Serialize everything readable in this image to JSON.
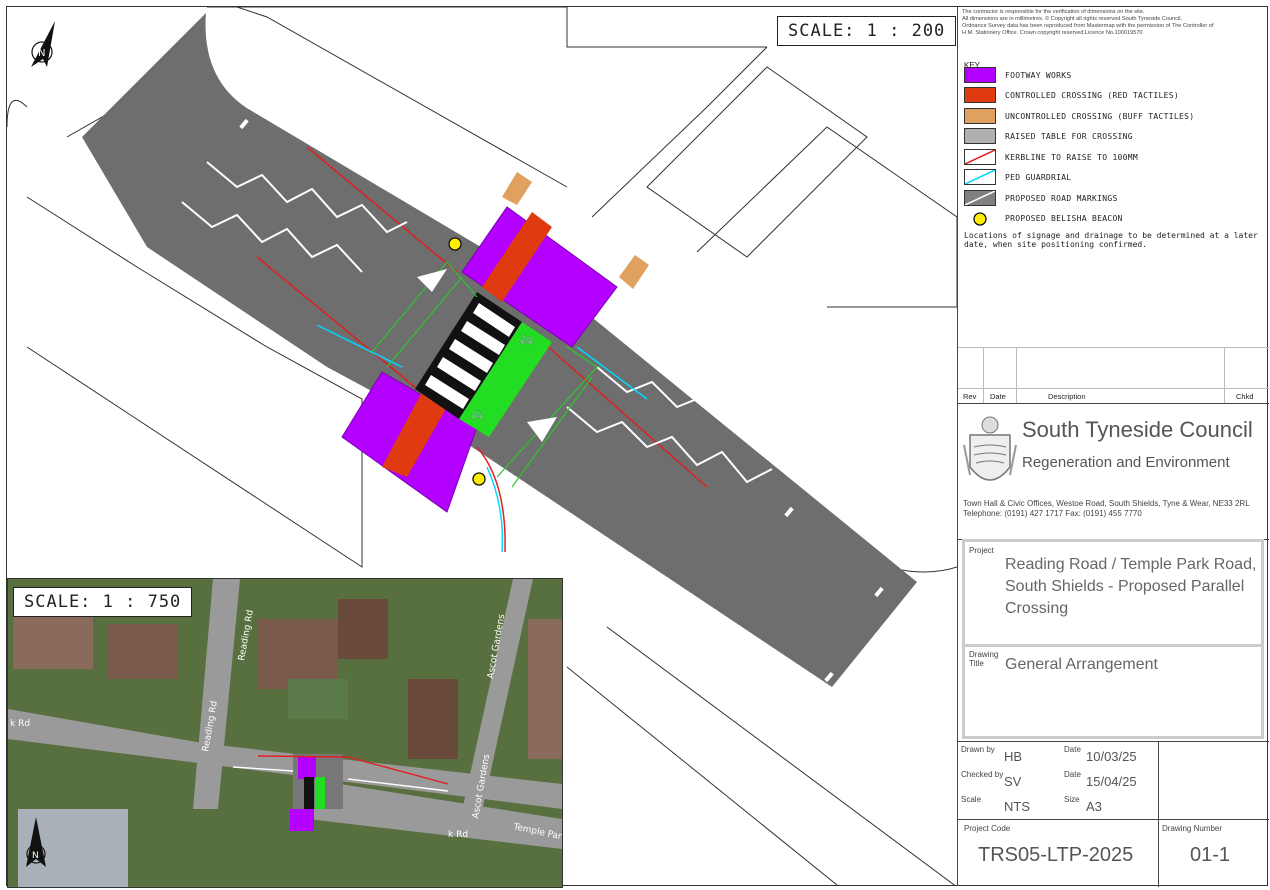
{
  "plan": {
    "scale_label": "SCALE: 1 : 200",
    "north_label": "N"
  },
  "inset": {
    "scale_label": "SCALE: 1 : 750",
    "street_labels": [
      "Reading Rd",
      "Reading Rd",
      "Ascot Gardens",
      "Ascot Gardens",
      "Temple Park",
      "k Rd",
      "k Rd"
    ],
    "north_label": "N"
  },
  "notes": [
    "The contractor is responsible for the verification of dimensions on the site.",
    "All dimensions are in millimetres. © Copyright all rights reserved South Tyneside Council.",
    "Ordnance Survey data has been reproduced from Mastermap with the permission of The Controller of",
    "H.M. Stationery Office. Crown copyright reserved.Licence No.100019570"
  ],
  "key": {
    "title": "KEY",
    "items": [
      {
        "label": "FOOTWAY WORKS",
        "color": "#b300ff"
      },
      {
        "label": "CONTROLLED CROSSING (RED TACTILES)",
        "color": "#e03a10"
      },
      {
        "label": "UNCONTROLLED CROSSING (BUFF TACTILES)",
        "color": "#e0a060"
      },
      {
        "label": "RAISED TABLE FOR CROSSING",
        "color": "#b0b0b0"
      },
      {
        "label": "KERBLINE TO RAISE TO 100MM",
        "color": "#ffffff"
      },
      {
        "label": "PED GUARDRIAL",
        "color": "#ffffff"
      },
      {
        "label": "PROPOSED ROAD MARKINGS",
        "color": "#808080"
      },
      {
        "label": "PROPOSED BELISHA BEACON",
        "color": "#ffee00"
      }
    ],
    "footnote": "Locations of signage and drainage to be determined at a later date, when site positioning confirmed."
  },
  "revisions": {
    "headers": [
      "Rev",
      "Date",
      "Description",
      "Chkd"
    ]
  },
  "council": {
    "name": "South Tyneside Council",
    "department": "Regeneration and Environment",
    "address": "Town Hall & Civic Offices, Westoe Road, South Shields, Tyne & Wear, NE33 2RL",
    "contact": "Telephone: (0191) 427 1717      Fax: (0191) 455 7770"
  },
  "project": {
    "label": "Project",
    "value": "Reading Road / Temple Park Road, South Shields - Proposed Parallel Crossing",
    "drawing_title_label_1": "Drawing",
    "drawing_title_label_2": "Title",
    "drawing_title": "General Arrangement"
  },
  "meta": {
    "drawn_by_label": "Drawn by",
    "drawn_by": "HB",
    "date1_label": "Date",
    "date1": "10/03/25",
    "checked_by_label": "Checked by",
    "checked_by": "SV",
    "date2_label": "Date",
    "date2": "15/04/25",
    "scale_label": "Scale",
    "scale": "NTS",
    "size_label": "Size",
    "size": "A3"
  },
  "codes": {
    "project_code_label": "Project Code",
    "project_code": "TRS05-LTP-2025",
    "drawing_number_label": "Drawing Number",
    "drawing_number": "01-1"
  }
}
